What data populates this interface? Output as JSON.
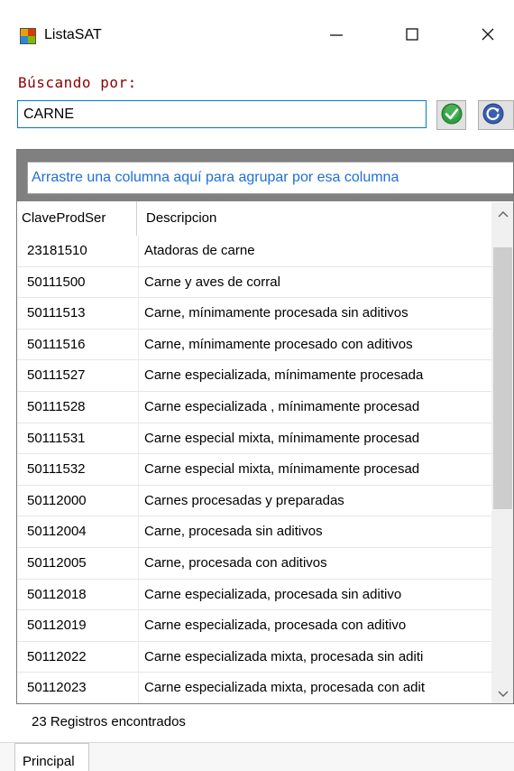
{
  "window": {
    "title": "ListaSAT",
    "icons": {
      "app": "window-app-icon",
      "minimize": "minimize-icon",
      "maximize": "maximize-icon",
      "close": "close-icon"
    }
  },
  "search": {
    "label": "Búscando por:",
    "value": "CARNE",
    "ok_icon": "green-check-icon",
    "reset_icon": "blue-refresh-icon",
    "accent_color": "#8b0000"
  },
  "grid": {
    "group_hint": "Arrastre una columna aquí para agrupar por esa columna",
    "columns": [
      "ClaveProdSer",
      "Descripcion"
    ],
    "rows": [
      {
        "clave": "23181510",
        "descripcion": "Atadoras de carne"
      },
      {
        "clave": "50111500",
        "descripcion": "Carne y aves de corral"
      },
      {
        "clave": "50111513",
        "descripcion": "Carne, mínimamente procesada sin aditivos"
      },
      {
        "clave": "50111516",
        "descripcion": "Carne, mínimamente procesado con aditivos"
      },
      {
        "clave": "50111527",
        "descripcion": "Carne especializada, mínimamente procesada"
      },
      {
        "clave": "50111528",
        "descripcion": "Carne especializada , mínimamente procesad"
      },
      {
        "clave": "50111531",
        "descripcion": "Carne especial mixta, mínimamente procesad"
      },
      {
        "clave": "50111532",
        "descripcion": "Carne especial mixta, mínimamente procesad"
      },
      {
        "clave": "50112000",
        "descripcion": "Carnes procesadas y preparadas"
      },
      {
        "clave": "50112004",
        "descripcion": "Carne, procesada sin aditivos"
      },
      {
        "clave": "50112005",
        "descripcion": "Carne, procesada con aditivos"
      },
      {
        "clave": "50112018",
        "descripcion": "Carne especializada, procesada sin aditivo"
      },
      {
        "clave": "50112019",
        "descripcion": "Carne especializada, procesada con aditivo"
      },
      {
        "clave": "50112022",
        "descripcion": "Carne especializada mixta, procesada sin aditi"
      },
      {
        "clave": "50112023",
        "descripcion": "Carne especializada mixta, procesada con adit"
      }
    ]
  },
  "status": {
    "text": "23 Registros encontrados"
  },
  "tabs": [
    {
      "label": "Principal"
    }
  ]
}
